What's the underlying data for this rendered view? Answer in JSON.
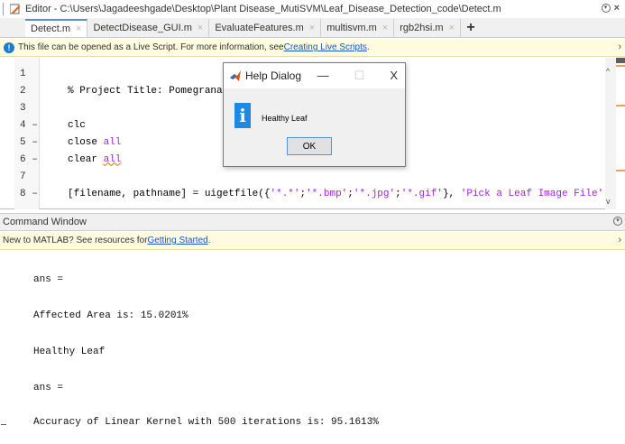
{
  "window": {
    "title": "Editor - C:\\Users\\Jagadeeshgade\\Desktop\\Plant Disease_MutiSVM\\Leaf_Disease_Detection_code\\Detect.m"
  },
  "tabs": [
    {
      "label": "Detect.m",
      "active": true
    },
    {
      "label": "DetectDisease_GUI.m",
      "active": false
    },
    {
      "label": "EvaluateFeatures.m",
      "active": false
    },
    {
      "label": "multisvm.m",
      "active": false
    },
    {
      "label": "rgb2hsi.m",
      "active": false
    }
  ],
  "tab_close_glyph": "×",
  "tab_add_glyph": "+",
  "live_script_bar": {
    "text": "This file can be opened as a Live Script. For more information, see ",
    "link": "Creating Live Scripts",
    "suffix": "."
  },
  "editor": {
    "lines": [
      {
        "num": "1",
        "marker": "",
        "code": ""
      },
      {
        "num": "2",
        "marker": "",
        "code": "% Project Title: Pomegranate"
      },
      {
        "num": "3",
        "marker": "",
        "code": ""
      },
      {
        "num": "4",
        "marker": "–",
        "code": "clc"
      },
      {
        "num": "5",
        "marker": "–",
        "code_pre": "close ",
        "code_kw": "all"
      },
      {
        "num": "6",
        "marker": "–",
        "code_pre": "clear ",
        "code_kw": "all"
      },
      {
        "num": "7",
        "marker": "",
        "code": ""
      },
      {
        "num": "8",
        "marker": "–",
        "code": "[filename, pathname] = uigetfile({'*.*';'*.bmp';'*.jpg';'*.gif'}, 'Pick a Leaf Image File');"
      }
    ]
  },
  "help_dialog": {
    "title": "Help Dialog",
    "message": "Healthy Leaf",
    "ok_label": "OK",
    "minimize_glyph": "—",
    "restore_glyph": "☐",
    "close_glyph": "X",
    "icon": "info-icon"
  },
  "command_window": {
    "header": "Command Window",
    "info_text": "New to MATLAB? See resources for ",
    "info_link": "Getting Started",
    "info_suffix": ".",
    "output": [
      "ans =",
      "Affected Area is: 15.0201%",
      "Healthy Leaf",
      "ans =",
      "Accuracy of Linear Kernel with 500 iterations is: 95.1613%"
    ]
  },
  "colors": {
    "comment": "#2b8a2b",
    "string": "#a020f0",
    "info_bar": "#fffbe0",
    "accent": "#5a8fd0"
  }
}
